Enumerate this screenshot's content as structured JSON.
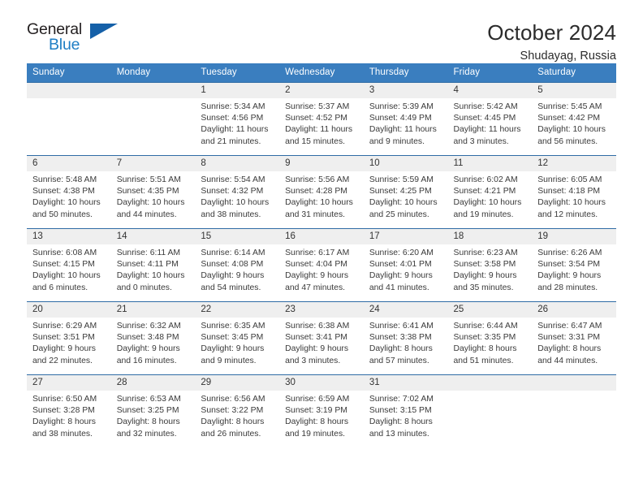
{
  "brand": {
    "name_part1": "General",
    "name_part2": "Blue",
    "accent_color": "#1560a8",
    "text_color": "#231f20"
  },
  "header": {
    "month_title": "October 2024",
    "location": "Shudayag, Russia"
  },
  "calendar": {
    "header_bg": "#3a7ebf",
    "row_border_color": "#2f6ba5",
    "daynum_bg": "#efefef",
    "weekday_headers": [
      "Sunday",
      "Monday",
      "Tuesday",
      "Wednesday",
      "Thursday",
      "Friday",
      "Saturday"
    ],
    "weeks": [
      [
        {
          "day": "",
          "empty": true
        },
        {
          "day": "",
          "empty": true
        },
        {
          "day": "1",
          "sunrise": "Sunrise: 5:34 AM",
          "sunset": "Sunset: 4:56 PM",
          "daylight_1": "Daylight: 11 hours",
          "daylight_2": "and 21 minutes."
        },
        {
          "day": "2",
          "sunrise": "Sunrise: 5:37 AM",
          "sunset": "Sunset: 4:52 PM",
          "daylight_1": "Daylight: 11 hours",
          "daylight_2": "and 15 minutes."
        },
        {
          "day": "3",
          "sunrise": "Sunrise: 5:39 AM",
          "sunset": "Sunset: 4:49 PM",
          "daylight_1": "Daylight: 11 hours",
          "daylight_2": "and 9 minutes."
        },
        {
          "day": "4",
          "sunrise": "Sunrise: 5:42 AM",
          "sunset": "Sunset: 4:45 PM",
          "daylight_1": "Daylight: 11 hours",
          "daylight_2": "and 3 minutes."
        },
        {
          "day": "5",
          "sunrise": "Sunrise: 5:45 AM",
          "sunset": "Sunset: 4:42 PM",
          "daylight_1": "Daylight: 10 hours",
          "daylight_2": "and 56 minutes."
        }
      ],
      [
        {
          "day": "6",
          "sunrise": "Sunrise: 5:48 AM",
          "sunset": "Sunset: 4:38 PM",
          "daylight_1": "Daylight: 10 hours",
          "daylight_2": "and 50 minutes."
        },
        {
          "day": "7",
          "sunrise": "Sunrise: 5:51 AM",
          "sunset": "Sunset: 4:35 PM",
          "daylight_1": "Daylight: 10 hours",
          "daylight_2": "and 44 minutes."
        },
        {
          "day": "8",
          "sunrise": "Sunrise: 5:54 AM",
          "sunset": "Sunset: 4:32 PM",
          "daylight_1": "Daylight: 10 hours",
          "daylight_2": "and 38 minutes."
        },
        {
          "day": "9",
          "sunrise": "Sunrise: 5:56 AM",
          "sunset": "Sunset: 4:28 PM",
          "daylight_1": "Daylight: 10 hours",
          "daylight_2": "and 31 minutes."
        },
        {
          "day": "10",
          "sunrise": "Sunrise: 5:59 AM",
          "sunset": "Sunset: 4:25 PM",
          "daylight_1": "Daylight: 10 hours",
          "daylight_2": "and 25 minutes."
        },
        {
          "day": "11",
          "sunrise": "Sunrise: 6:02 AM",
          "sunset": "Sunset: 4:21 PM",
          "daylight_1": "Daylight: 10 hours",
          "daylight_2": "and 19 minutes."
        },
        {
          "day": "12",
          "sunrise": "Sunrise: 6:05 AM",
          "sunset": "Sunset: 4:18 PM",
          "daylight_1": "Daylight: 10 hours",
          "daylight_2": "and 12 minutes."
        }
      ],
      [
        {
          "day": "13",
          "sunrise": "Sunrise: 6:08 AM",
          "sunset": "Sunset: 4:15 PM",
          "daylight_1": "Daylight: 10 hours",
          "daylight_2": "and 6 minutes."
        },
        {
          "day": "14",
          "sunrise": "Sunrise: 6:11 AM",
          "sunset": "Sunset: 4:11 PM",
          "daylight_1": "Daylight: 10 hours",
          "daylight_2": "and 0 minutes."
        },
        {
          "day": "15",
          "sunrise": "Sunrise: 6:14 AM",
          "sunset": "Sunset: 4:08 PM",
          "daylight_1": "Daylight: 9 hours",
          "daylight_2": "and 54 minutes."
        },
        {
          "day": "16",
          "sunrise": "Sunrise: 6:17 AM",
          "sunset": "Sunset: 4:04 PM",
          "daylight_1": "Daylight: 9 hours",
          "daylight_2": "and 47 minutes."
        },
        {
          "day": "17",
          "sunrise": "Sunrise: 6:20 AM",
          "sunset": "Sunset: 4:01 PM",
          "daylight_1": "Daylight: 9 hours",
          "daylight_2": "and 41 minutes."
        },
        {
          "day": "18",
          "sunrise": "Sunrise: 6:23 AM",
          "sunset": "Sunset: 3:58 PM",
          "daylight_1": "Daylight: 9 hours",
          "daylight_2": "and 35 minutes."
        },
        {
          "day": "19",
          "sunrise": "Sunrise: 6:26 AM",
          "sunset": "Sunset: 3:54 PM",
          "daylight_1": "Daylight: 9 hours",
          "daylight_2": "and 28 minutes."
        }
      ],
      [
        {
          "day": "20",
          "sunrise": "Sunrise: 6:29 AM",
          "sunset": "Sunset: 3:51 PM",
          "daylight_1": "Daylight: 9 hours",
          "daylight_2": "and 22 minutes."
        },
        {
          "day": "21",
          "sunrise": "Sunrise: 6:32 AM",
          "sunset": "Sunset: 3:48 PM",
          "daylight_1": "Daylight: 9 hours",
          "daylight_2": "and 16 minutes."
        },
        {
          "day": "22",
          "sunrise": "Sunrise: 6:35 AM",
          "sunset": "Sunset: 3:45 PM",
          "daylight_1": "Daylight: 9 hours",
          "daylight_2": "and 9 minutes."
        },
        {
          "day": "23",
          "sunrise": "Sunrise: 6:38 AM",
          "sunset": "Sunset: 3:41 PM",
          "daylight_1": "Daylight: 9 hours",
          "daylight_2": "and 3 minutes."
        },
        {
          "day": "24",
          "sunrise": "Sunrise: 6:41 AM",
          "sunset": "Sunset: 3:38 PM",
          "daylight_1": "Daylight: 8 hours",
          "daylight_2": "and 57 minutes."
        },
        {
          "day": "25",
          "sunrise": "Sunrise: 6:44 AM",
          "sunset": "Sunset: 3:35 PM",
          "daylight_1": "Daylight: 8 hours",
          "daylight_2": "and 51 minutes."
        },
        {
          "day": "26",
          "sunrise": "Sunrise: 6:47 AM",
          "sunset": "Sunset: 3:31 PM",
          "daylight_1": "Daylight: 8 hours",
          "daylight_2": "and 44 minutes."
        }
      ],
      [
        {
          "day": "27",
          "sunrise": "Sunrise: 6:50 AM",
          "sunset": "Sunset: 3:28 PM",
          "daylight_1": "Daylight: 8 hours",
          "daylight_2": "and 38 minutes."
        },
        {
          "day": "28",
          "sunrise": "Sunrise: 6:53 AM",
          "sunset": "Sunset: 3:25 PM",
          "daylight_1": "Daylight: 8 hours",
          "daylight_2": "and 32 minutes."
        },
        {
          "day": "29",
          "sunrise": "Sunrise: 6:56 AM",
          "sunset": "Sunset: 3:22 PM",
          "daylight_1": "Daylight: 8 hours",
          "daylight_2": "and 26 minutes."
        },
        {
          "day": "30",
          "sunrise": "Sunrise: 6:59 AM",
          "sunset": "Sunset: 3:19 PM",
          "daylight_1": "Daylight: 8 hours",
          "daylight_2": "and 19 minutes."
        },
        {
          "day": "31",
          "sunrise": "Sunrise: 7:02 AM",
          "sunset": "Sunset: 3:15 PM",
          "daylight_1": "Daylight: 8 hours",
          "daylight_2": "and 13 minutes."
        },
        {
          "day": "",
          "empty": true
        },
        {
          "day": "",
          "empty": true
        }
      ]
    ]
  }
}
